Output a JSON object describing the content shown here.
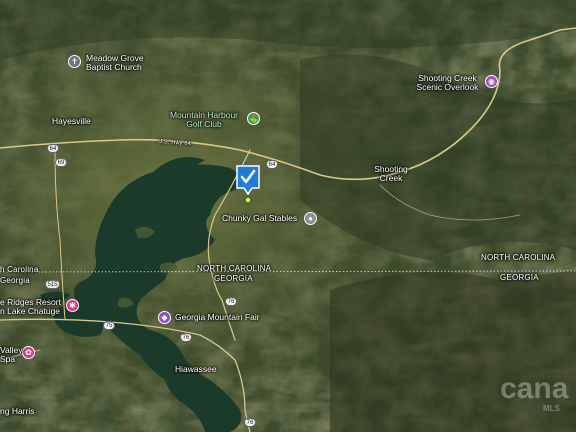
{
  "map": {
    "type": "satellite",
    "border_color": "#ffffff",
    "lake_color": "#1b3a2a",
    "road_color": "#d8c88a"
  },
  "places": {
    "meadow_grove": "Meadow Grove\nBaptist Church",
    "hayesville": "Hayesville",
    "mountain_harbour": "Mountain Harbour\nGolf Club",
    "us_hwy_64": "U.S. Hwy 64",
    "shooting_creek_overlook": "Shooting Creek\nScenic Overlook",
    "shooting_creek": "Shooting\nCreek",
    "chunky_gal": "Chunky Gal Stables",
    "nc_label_center": "NORTH CAROLINA",
    "ga_label_center": "GEORGIA",
    "nc_label_right": "NORTH CAROLINA",
    "ga_label_right": "GEORGIA",
    "nc_label_left": "h Carolina",
    "ga_label_left": "Georgia",
    "ridges_resort": "e Ridges Resort\nn Lake Chatuge",
    "georgia_mountain_fair": "Georgia Mountain Fair",
    "hiawassee": "Hiawassee",
    "valley_spa": "Valley\nSpa",
    "young_harris": "ng Harris"
  },
  "shields": {
    "us64_a": "64",
    "nc69": "69",
    "us64_b": "64",
    "r515": "515",
    "r76_a": "76",
    "r75": "75",
    "r76_b": "76",
    "r76_c": "76"
  },
  "icons": {
    "meadow_grove": "church-icon",
    "mountain_harbour": "golf-icon",
    "chunky_gal": "place-icon",
    "shooting_creek_overlook": "camera-icon",
    "ridges_resort": "hotel-icon",
    "georgia_mountain_fair": "shopping-icon",
    "valley_spa": "spa-icon",
    "listing_marker": "property-marker-icon"
  },
  "watermark": {
    "brand": "cana",
    "sub": "MLS"
  }
}
